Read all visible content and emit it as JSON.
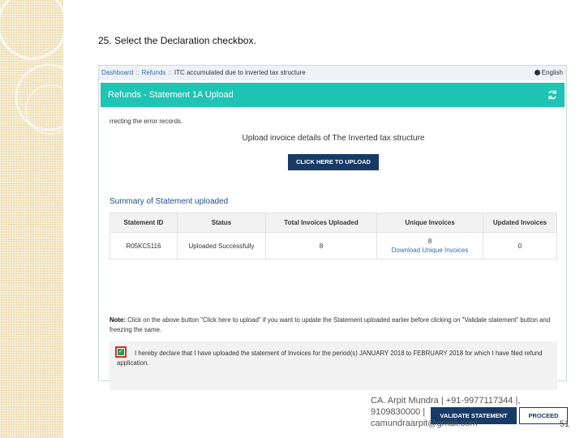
{
  "slide": {
    "step_title": "25. Select the Declaration checkbox.",
    "footer_line1": "CA. Arpit Mundra | +91-9977117344 |,",
    "footer_line2": "9109830000 |",
    "footer_line3": "camundraarpit@gmail.com",
    "page_number": "51"
  },
  "breadcrumb": {
    "items": [
      "Dashboard",
      "Refunds",
      "ITC accumulated due to inverted tax structure"
    ],
    "separator": "::"
  },
  "language": "English",
  "panel": {
    "title": "Refunds - Statement 1A Upload",
    "header_color": "#1ec4b4"
  },
  "content": {
    "error_text": "rrecting the error records.",
    "upload_caption": "Upload invoice details of The Inverted tax structure",
    "upload_button": "CLICK HERE TO UPLOAD",
    "summary_title": "Summary of Statement uploaded"
  },
  "table": {
    "headers": [
      "Statement ID",
      "Status",
      "Total Invoices Uploaded",
      "Unique Invoices",
      "Updated Invoices"
    ],
    "rows": [
      {
        "statement_id": "R05KC5116",
        "status": "Uploaded Successfully",
        "total": "8",
        "unique": "8",
        "unique_link": "Download Unique Invoices",
        "updated": "0"
      }
    ]
  },
  "note": {
    "label": "Note:",
    "text": "Click on the above button \"Click here to upload\" if you want to update the Statement uploaded earlier before clicking on \"Validate statement\" button and freezing the same."
  },
  "declaration": {
    "checked": true,
    "text": "I hereby declare that I have uploaded the statement of Invoices for the period(s) JANUARY 2018 to FEBRUARY 2018 for which I have filed refund application."
  },
  "buttons": {
    "validate": "VALIDATE STATEMENT",
    "proceed": "PROCEED"
  },
  "colors": {
    "accent_dark": "#173a66",
    "link": "#2f6fb3",
    "highlight": "#e0262c",
    "checkbox": "#1aa34a"
  }
}
